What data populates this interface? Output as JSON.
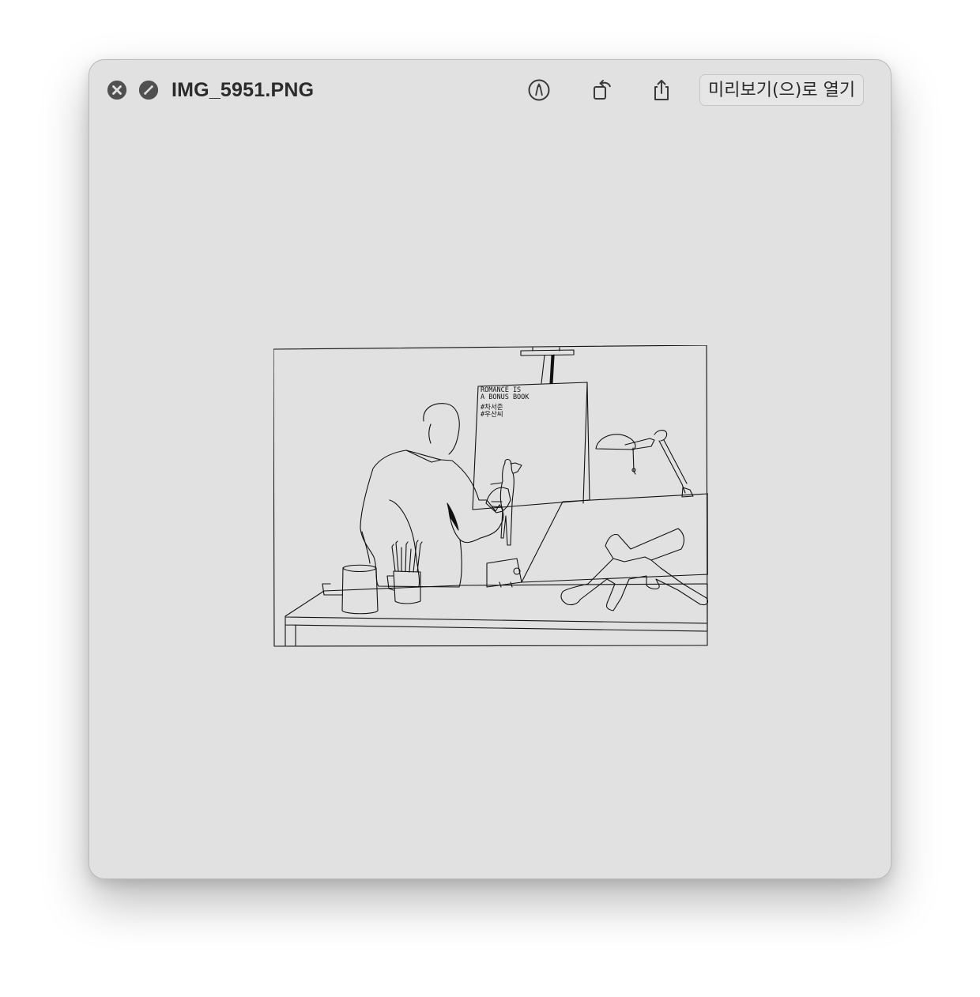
{
  "window": {
    "title": "IMG_5951.PNG",
    "background_color": "#e1e1e1"
  },
  "toolbar": {
    "close_icon": "close-icon",
    "fullscreen_icon": "fullscreen-icon",
    "markup_icon": "markup-pen-icon",
    "rotate_icon": "rotate-left-icon",
    "share_icon": "share-icon",
    "open_with_label": "미리보기(으)로 열기"
  },
  "image": {
    "description_type": "line drawing",
    "easel_text": [
      "ROMANCE IS",
      "A BONUS BOOK",
      "#차서준",
      "#우산씨"
    ]
  }
}
